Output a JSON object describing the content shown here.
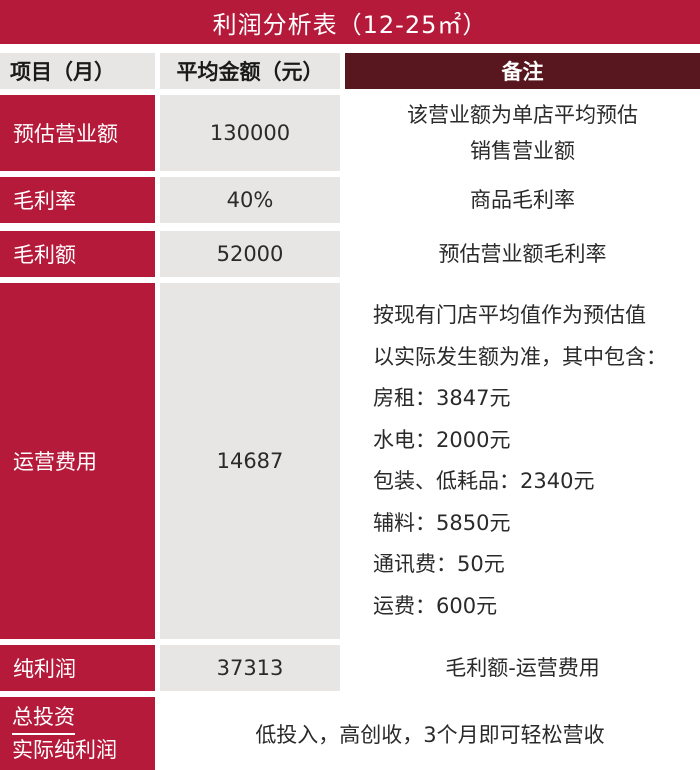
{
  "title": "利润分析表（12-25㎡）",
  "header": {
    "col1": "项目（月）",
    "col2": "平均金额（元）",
    "col3": "备注"
  },
  "rows": [
    {
      "label": "预估营业额",
      "amount": "130000",
      "note_lines": [
        "该营业额为单店平均预估",
        "销售营业额"
      ]
    },
    {
      "label": "毛利率",
      "amount": "40%",
      "note_lines": [
        "商品毛利率"
      ]
    },
    {
      "label": "毛利额",
      "amount": "52000",
      "note_lines": [
        "预估营业额毛利率"
      ]
    },
    {
      "label": "运营费用",
      "amount": "14687",
      "note_lines": [
        "按现有门店平均值作为预估值",
        "以实际发生额为准，其中包含：",
        "房租：3847元",
        "水电：2000元",
        "包装、低耗品：2340元",
        "辅料：5850元",
        "通讯费：50元",
        "运费：600元"
      ]
    },
    {
      "label": "纯利润",
      "amount": "37313",
      "note_lines": [
        "毛利额-运营费用"
      ]
    }
  ],
  "footer": {
    "label_top": "总投资",
    "label_bottom": "实际纯利润",
    "text": "低投入，高创收，3个月即可轻松营收"
  }
}
